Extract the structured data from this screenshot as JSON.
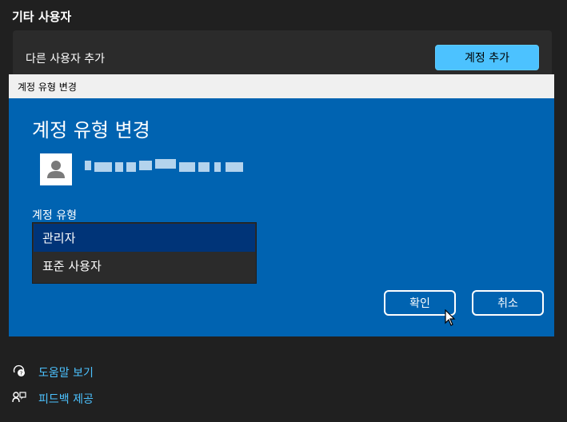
{
  "settings": {
    "section_title": "기타 사용자",
    "add_other_user_label": "다른 사용자 추가",
    "add_account_button": "계정 추가"
  },
  "dialog": {
    "window_title": "계정 유형 변경",
    "heading": "계정 유형 변경",
    "account_type_label": "계정 유형",
    "options": [
      "관리자",
      "표준 사용자"
    ],
    "selected_option": "관리자",
    "ok_button": "확인",
    "cancel_button": "취소"
  },
  "footer_links": {
    "help": "도움말 보기",
    "feedback": "피드백 제공"
  },
  "icons": {
    "avatar": "user-avatar-icon",
    "help": "help-icon",
    "feedback": "feedback-icon",
    "cursor": "mouse-pointer-icon"
  },
  "colors": {
    "background": "#202020",
    "card": "#2b2b2b",
    "accent": "#4cc2ff",
    "dialog_background": "#0063b1",
    "selected_option": "#003478"
  }
}
